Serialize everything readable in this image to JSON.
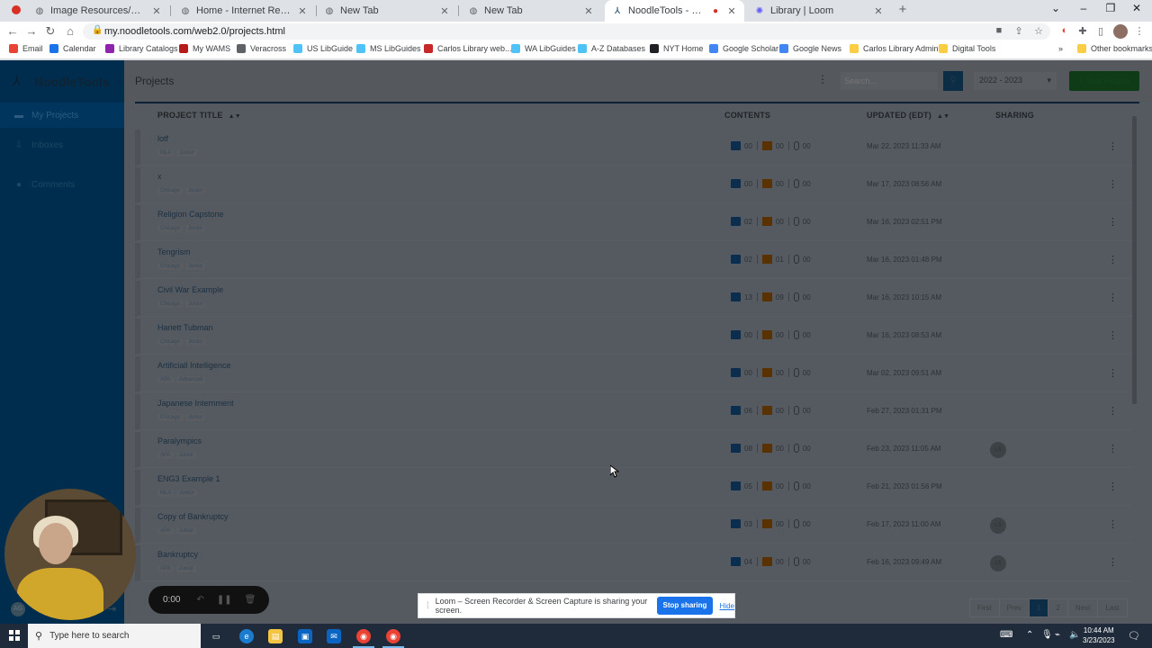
{
  "browser": {
    "tabs": [
      {
        "title": "Image Resources/Citations - @C",
        "favicon": "globe-icon"
      },
      {
        "title": "Home - Internet Resources - Lib",
        "favicon": "globe-icon"
      },
      {
        "title": "New Tab",
        "favicon": "globe-icon"
      },
      {
        "title": "New Tab",
        "favicon": "globe-icon"
      },
      {
        "title": "NoodleTools - Projects",
        "favicon": "noodletools-icon",
        "active": true
      },
      {
        "title": "Library | Loom",
        "favicon": "loom-icon"
      }
    ],
    "url": "my.noodletools.com/web2.0/projects.html",
    "bookmarks": [
      {
        "label": "Email",
        "color": "#ea4335",
        "icon": "google-icon"
      },
      {
        "label": "Calendar",
        "color": "#1a73e8",
        "icon": "calendar-icon"
      },
      {
        "label": "Library Catalogs",
        "color": "#8e24aa",
        "icon": "catalog-icon"
      },
      {
        "label": "My WAMS",
        "color": "#b71c1c",
        "icon": "wams-icon"
      },
      {
        "label": "Veracross",
        "color": "#5f6368",
        "icon": "veracross-icon"
      },
      {
        "label": "US LibGuide",
        "color": "#4fc3f7",
        "icon": "cloud-icon"
      },
      {
        "label": "MS LibGuides",
        "color": "#4fc3f7",
        "icon": "cloud-icon"
      },
      {
        "label": "Carlos Library web...",
        "color": "#c62828",
        "icon": "wa-icon"
      },
      {
        "label": "WA LibGuides",
        "color": "#4fc3f7",
        "icon": "cloud-icon"
      },
      {
        "label": "A-Z Databases",
        "color": "#4fc3f7",
        "icon": "cloud-icon"
      },
      {
        "label": "NYT Home",
        "color": "#202124",
        "icon": "nyt-icon"
      },
      {
        "label": "Google Scholar",
        "color": "#4285f4",
        "icon": "scholar-icon"
      },
      {
        "label": "Google News",
        "color": "#4285f4",
        "icon": "news-icon"
      },
      {
        "label": "Carlos Library Admin",
        "color": "#f9ce45",
        "icon": "folder-icon"
      },
      {
        "label": "Digital Tools",
        "color": "#f9ce45",
        "icon": "folder-icon"
      }
    ],
    "other_bookmarks": "Other bookmarks"
  },
  "app": {
    "brand": "NoodleTools",
    "page_title": "Projects",
    "search_placeholder": "Search...",
    "year": "2022 - 2023",
    "new_project": "+ New Project",
    "sidebar": [
      {
        "label": "My Projects",
        "icon": "folder-icon"
      },
      {
        "label": "Inboxes",
        "icon": "inbox-icon"
      },
      {
        "label": "Comments",
        "icon": "comment-icon"
      }
    ],
    "columns": {
      "title": "PROJECT TITLE",
      "contents": "CONTENTS",
      "updated": "UPDATED (EDT)",
      "sharing": "SHARING"
    },
    "projects": [
      {
        "title": "lotf",
        "style": "MLA",
        "level": "Junior",
        "sources": "00",
        "notecards": "00",
        "attachments": "00",
        "updated": "Mar 22, 2023 11:33 AM",
        "sharing": ""
      },
      {
        "title": "x",
        "style": "Chicago",
        "level": "Junior",
        "sources": "00",
        "notecards": "00",
        "attachments": "00",
        "updated": "Mar 17, 2023 08:56 AM",
        "sharing": ""
      },
      {
        "title": "Religion Capstone",
        "style": "Chicago",
        "level": "Junior",
        "sources": "02",
        "notecards": "00",
        "attachments": "00",
        "updated": "Mar 16, 2023 02:51 PM",
        "sharing": ""
      },
      {
        "title": "Tengrism",
        "style": "Chicago",
        "level": "Junior",
        "sources": "02",
        "notecards": "01",
        "attachments": "00",
        "updated": "Mar 16, 2023 01:48 PM",
        "sharing": ""
      },
      {
        "title": "Civil War Example",
        "style": "Chicago",
        "level": "Junior",
        "sources": "13",
        "notecards": "09",
        "attachments": "00",
        "updated": "Mar 16, 2023 10:15 AM",
        "sharing": ""
      },
      {
        "title": "Hariett Tubman",
        "style": "Chicago",
        "level": "Junior",
        "sources": "00",
        "notecards": "00",
        "attachments": "00",
        "updated": "Mar 16, 2023 08:53 AM",
        "sharing": ""
      },
      {
        "title": "Artificiall Intelligence",
        "style": "APA",
        "level": "Advanced",
        "sources": "00",
        "notecards": "00",
        "attachments": "00",
        "updated": "Mar 02, 2023 09:51 AM",
        "sharing": ""
      },
      {
        "title": "Japanese Internment",
        "style": "Chicago",
        "level": "Junior",
        "sources": "06",
        "notecards": "00",
        "attachments": "00",
        "updated": "Feb 27, 2023 01:31 PM",
        "sharing": ""
      },
      {
        "title": "Paralympics",
        "style": "APA",
        "level": "Junior",
        "sources": "08",
        "notecards": "00",
        "attachments": "00",
        "updated": "Feb 23, 2023 11:05 AM",
        "sharing": "LS"
      },
      {
        "title": "ENG3 Example 1",
        "style": "MLA",
        "level": "Junior",
        "sources": "05",
        "notecards": "00",
        "attachments": "00",
        "updated": "Feb 21, 2023 01:56 PM",
        "sharing": ""
      },
      {
        "title": "Copy of Bankruptcy",
        "style": "APA",
        "level": "Junior",
        "sources": "03",
        "notecards": "00",
        "attachments": "00",
        "updated": "Feb 17, 2023 11:00 AM",
        "sharing": "LS"
      },
      {
        "title": "Bankruptcy",
        "style": "APA",
        "level": "Junior",
        "sources": "04",
        "notecards": "00",
        "attachments": "00",
        "updated": "Feb 16, 2023 09:49 AM",
        "sharing": "LS"
      }
    ],
    "pager": [
      "First",
      "Prev",
      "1",
      "2",
      "Next",
      "Last"
    ],
    "pager_active": "1",
    "user_initials": "AG"
  },
  "loom": {
    "timer": "0:00",
    "share_message": "Loom – Screen Recorder & Screen Capture is sharing your screen.",
    "stop_label": "Stop sharing",
    "hide_label": "Hide"
  },
  "taskbar": {
    "search_placeholder": "Type here to search",
    "time": "10:44 AM",
    "date": "3/23/2023"
  }
}
